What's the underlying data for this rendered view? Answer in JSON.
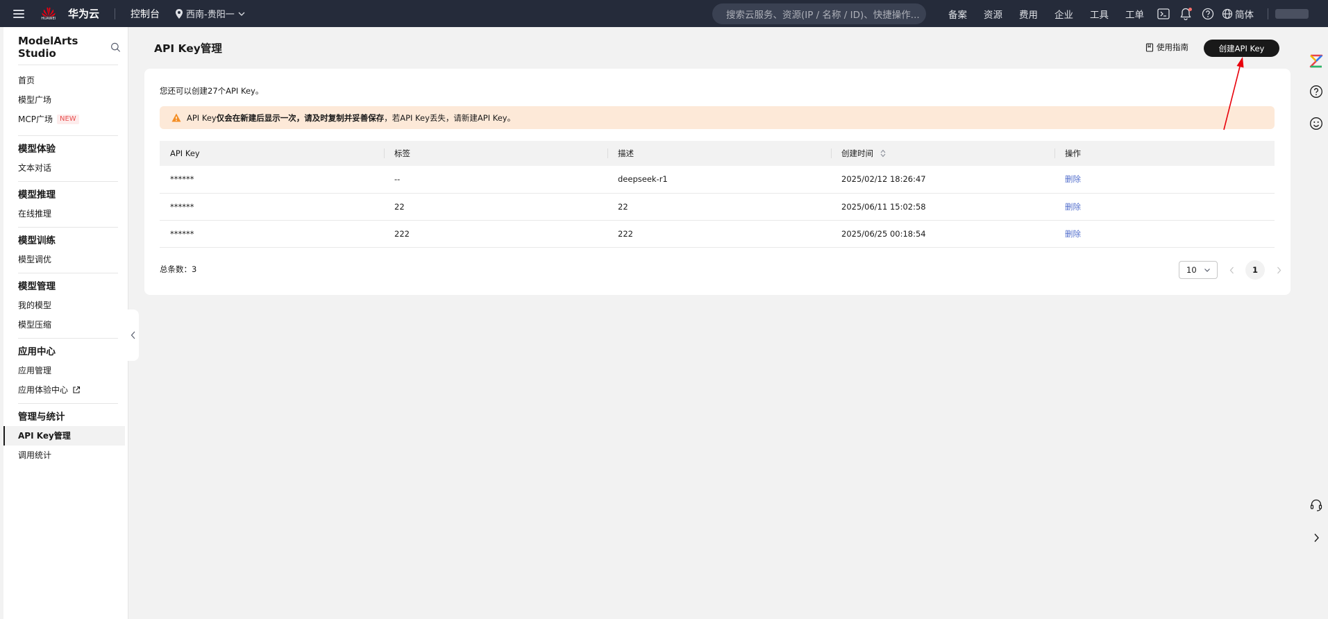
{
  "topbar": {
    "brand_small": "HUAWEI",
    "brand": "华为云",
    "console": "控制台",
    "region": "西南-贵阳一",
    "search_placeholder": "搜索云服务、资源(IP / 名称 / ID)、快捷操作...",
    "nav": [
      "备案",
      "资源",
      "费用",
      "企业",
      "工具",
      "工单"
    ],
    "language": "简体"
  },
  "sidebar": {
    "title": "ModelArts Studio",
    "top_items": [
      {
        "label": "首页"
      },
      {
        "label": "模型广场"
      },
      {
        "label": "MCP广场",
        "badge": "NEW"
      }
    ],
    "groups": [
      {
        "title": "模型体验",
        "items": [
          "文本对话"
        ]
      },
      {
        "title": "模型推理",
        "items": [
          "在线推理"
        ]
      },
      {
        "title": "模型训练",
        "items": [
          "模型调优"
        ]
      },
      {
        "title": "模型管理",
        "items": [
          "我的模型",
          "模型压缩"
        ]
      },
      {
        "title": "应用中心",
        "items": [
          "应用管理",
          "应用体验中心"
        ]
      },
      {
        "title": "管理与统计",
        "items": [
          "API Key管理",
          "调用统计"
        ]
      }
    ],
    "active_item": "API Key管理"
  },
  "main": {
    "title": "API Key管理",
    "guide": "使用指南",
    "create_button": "创建API Key",
    "remaining": "您还可以创建27个API Key。",
    "alert": {
      "prefix": "API Key",
      "bold": "仅会在新建后显示一次，请及时复制并妥善保存",
      "suffix": "，若API Key丢失，请新建API Key。"
    },
    "table": {
      "columns": [
        "API Key",
        "标签",
        "描述",
        "创建时间",
        "操作"
      ],
      "rows": [
        {
          "key": "******",
          "tag": "--",
          "desc": "deepseek-r1",
          "created": "2025/02/12 18:26:47",
          "action": "删除"
        },
        {
          "key": "******",
          "tag": "22",
          "desc": "22",
          "created": "2025/06/11 15:02:58",
          "action": "删除"
        },
        {
          "key": "******",
          "tag": "222",
          "desc": "222",
          "created": "2025/06/25 00:18:54",
          "action": "删除"
        }
      ]
    },
    "total": "总条数：3",
    "page_size": "10",
    "current_page": "1"
  },
  "colors": {
    "topbar": "#252b3a",
    "accent_link": "#526ecc",
    "alert_bg": "#fde9d8",
    "annotation": "#e8000b"
  }
}
